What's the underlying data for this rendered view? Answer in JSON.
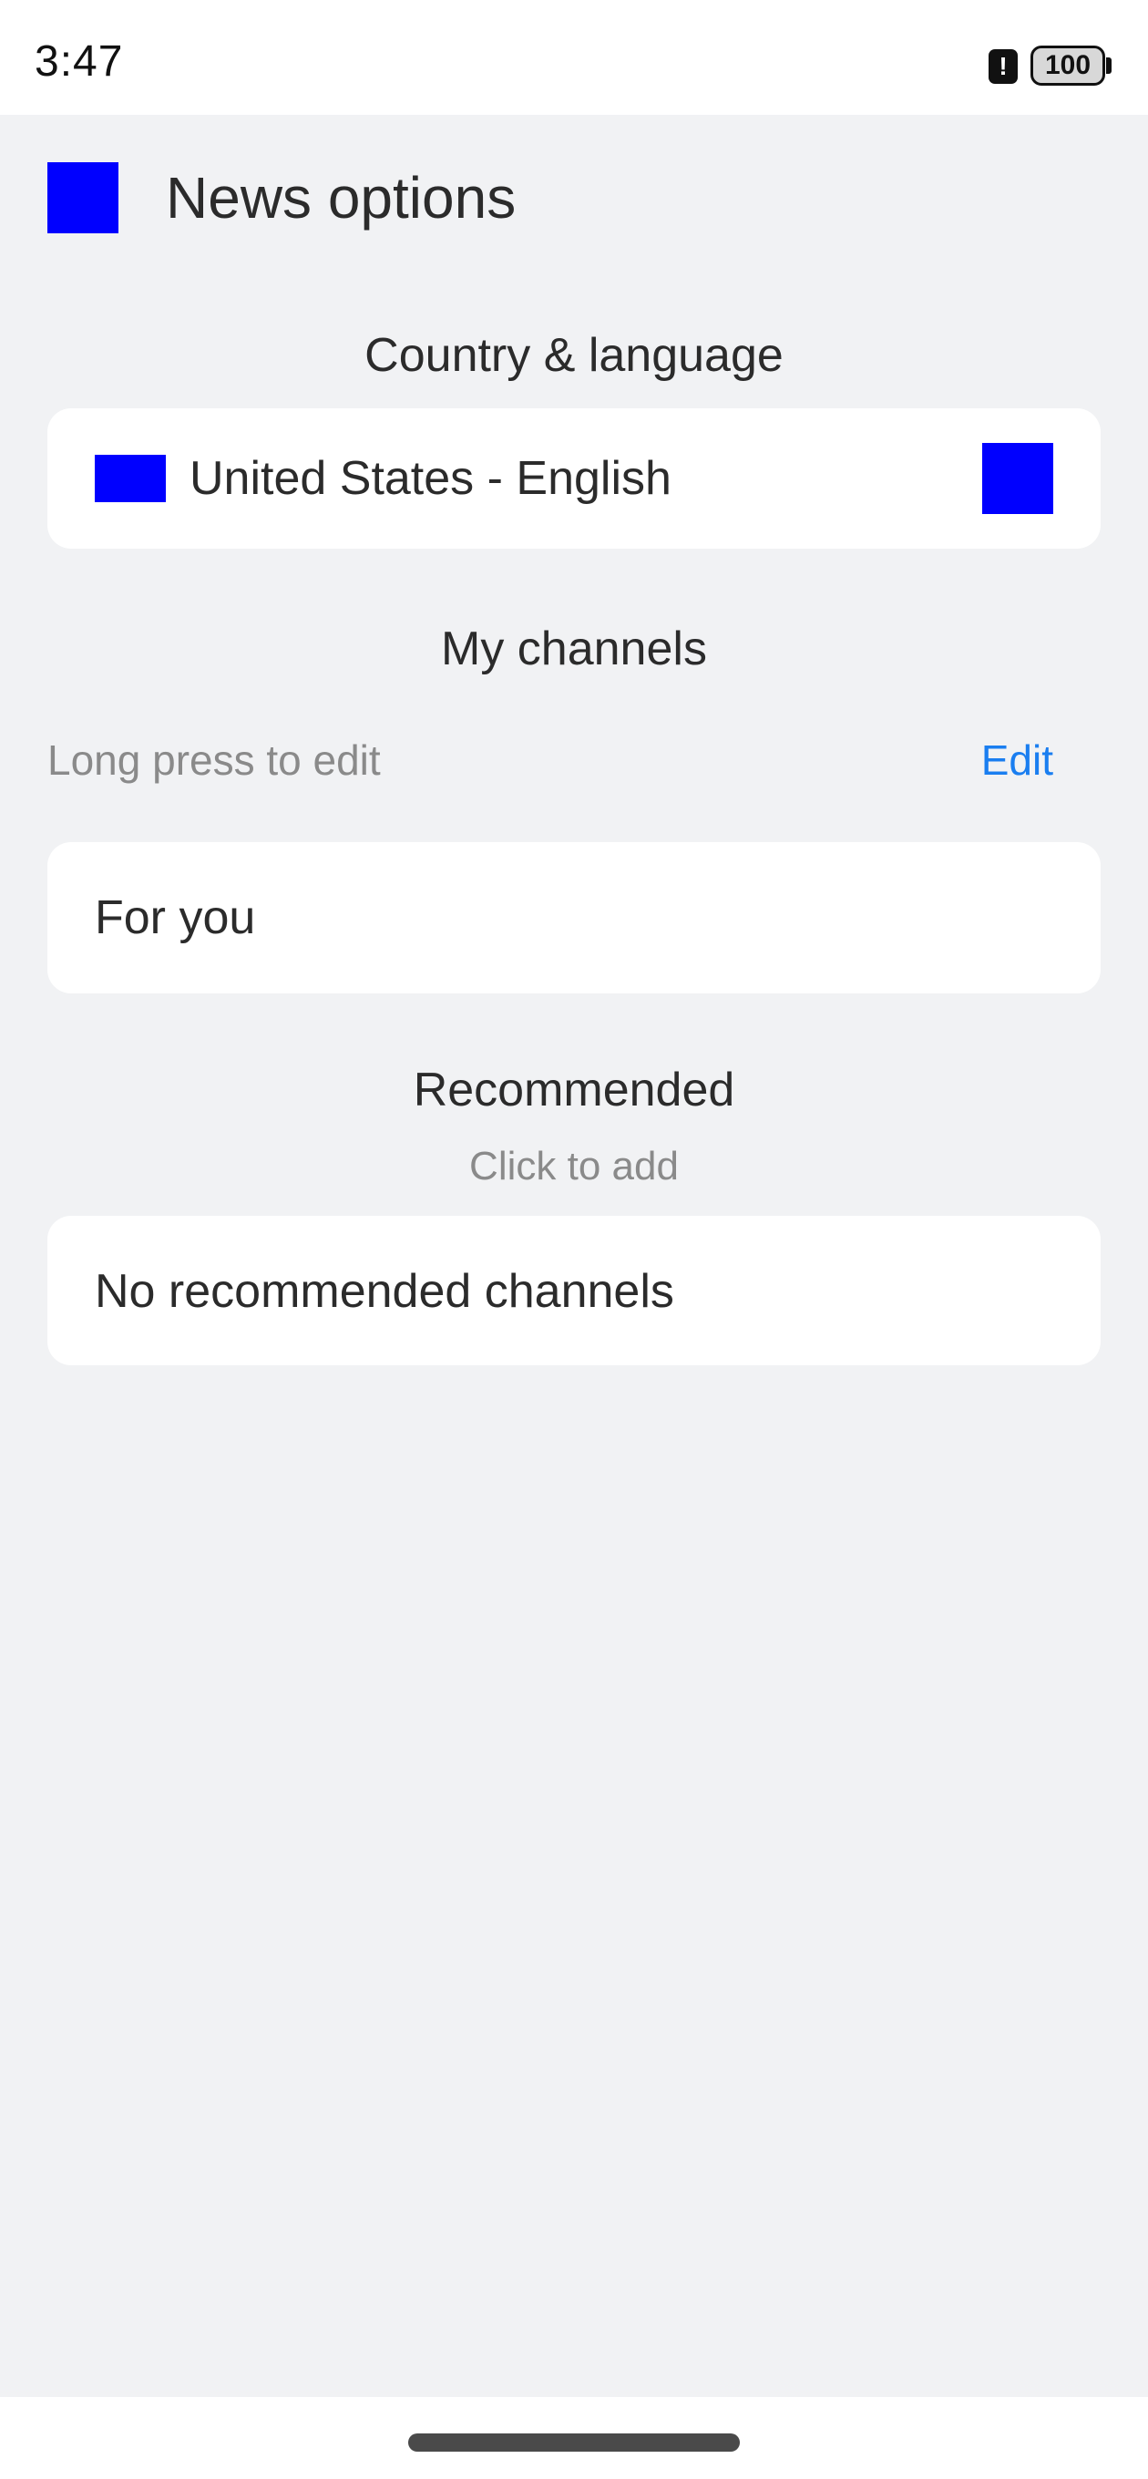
{
  "status_bar": {
    "time": "3:47",
    "alert_icon": "!",
    "battery": "100"
  },
  "header": {
    "title": "News options",
    "back_icon": "back-icon"
  },
  "country_section": {
    "title": "Country & language",
    "selected": "United States - English",
    "flag_icon": "flag-icon",
    "chevron_icon": "chevron-right-icon"
  },
  "channels_section": {
    "title": "My channels",
    "hint": "Long press to edit",
    "edit_label": "Edit",
    "channels": [
      "For you"
    ]
  },
  "recommended_section": {
    "title": "Recommended",
    "subtitle": "Click to add",
    "empty_text": "No recommended channels"
  },
  "colors": {
    "accent": "#1a7ef0",
    "background": "#f1f2f4",
    "card": "#ffffff",
    "placeholder_icon": "#0000ff"
  }
}
